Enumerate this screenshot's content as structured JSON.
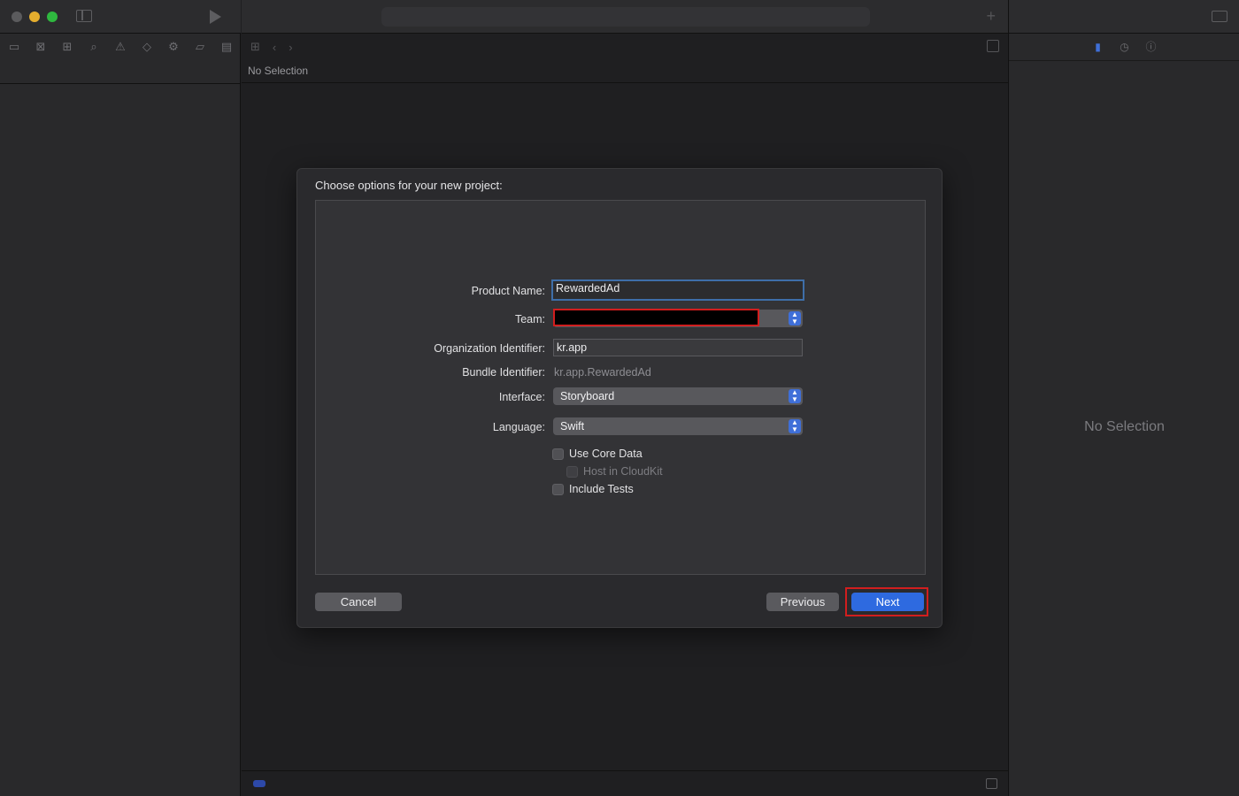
{
  "window": {
    "editor_jumpbar": "No Selection",
    "inspector_empty": "No Selection"
  },
  "sheet": {
    "title": "Choose options for your new project:",
    "fields": {
      "product_name_label": "Product Name:",
      "product_name_value": "RewardedAd",
      "team_label": "Team:",
      "org_id_label": "Organization Identifier:",
      "org_id_value": "kr.app",
      "bundle_id_label": "Bundle Identifier:",
      "bundle_id_value": "kr.app.RewardedAd",
      "interface_label": "Interface:",
      "interface_value": "Storyboard",
      "language_label": "Language:",
      "language_value": "Swift"
    },
    "checkboxes": {
      "use_core_data": "Use Core Data",
      "host_in_cloudkit": "Host in CloudKit",
      "include_tests": "Include Tests"
    },
    "buttons": {
      "cancel": "Cancel",
      "previous": "Previous",
      "next": "Next"
    }
  },
  "colors": {
    "accent": "#2e6ae0",
    "highlight": "#d11e1e"
  }
}
